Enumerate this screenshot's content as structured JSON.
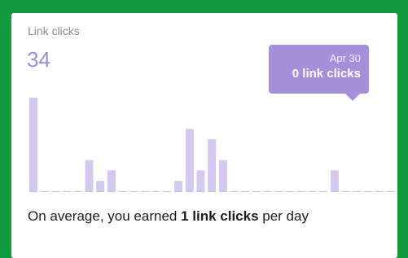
{
  "card": {
    "label": "Link clicks",
    "value": "34",
    "tooltip": {
      "date": "Apr 30",
      "text": "0 link clicks"
    },
    "summary": {
      "prefix": "On average, you earned ",
      "highlight": "1 link clicks",
      "suffix": " per day"
    }
  },
  "colors": {
    "bar": "#d3c8ee",
    "baseline": "#c8c8c8",
    "tooltip": "#a58fdb",
    "value": "#9c8cd0"
  },
  "chart_data": {
    "type": "bar",
    "values": [
      9,
      0,
      0,
      0,
      0,
      3,
      1,
      2,
      0,
      0,
      0,
      0,
      0,
      1,
      6,
      2,
      5,
      3,
      0,
      0,
      0,
      0,
      0,
      0,
      0,
      0,
      0,
      2,
      0,
      0,
      0,
      0,
      0,
      0,
      0
    ],
    "ylim": [
      0,
      9
    ],
    "highlighted": {
      "label": "Apr 30",
      "value": 0
    }
  }
}
